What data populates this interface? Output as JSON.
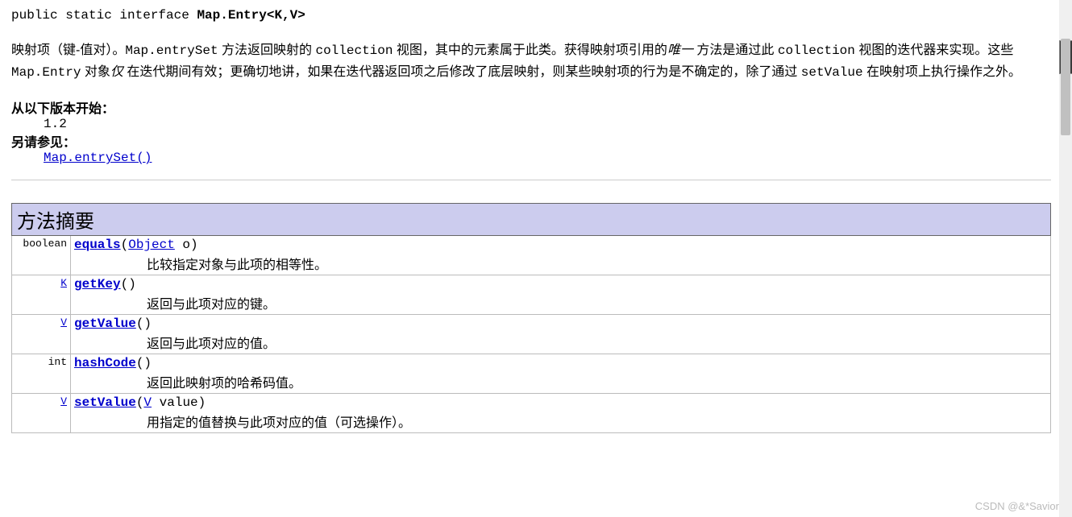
{
  "declaration": {
    "prefix": "public static interface ",
    "name": "Map.Entry<K,V>"
  },
  "description": {
    "p1a": "映射项（键-值对）。",
    "m1": "Map.entrySet",
    "p1b": " 方法返回映射的 ",
    "m2": "collection",
    "p1c": " 视图，其中的元素属于此类。获得映射项引用的",
    "only": "唯一",
    "p1d": " 方法是通过此 ",
    "m3": "collection",
    "p1e": " 视图的迭代器来实现。这些 ",
    "m4": "Map.Entry",
    "p1f": " 对象",
    "only2": "仅",
    "p1g": " 在迭代期间有效；更确切地讲，如果在迭代器返回项之后修改了底层映射，则某些映射项的行为是不确定的，除了通过 ",
    "m5": "setValue",
    "p1h": " 在映射项上执行操作之外。"
  },
  "meta": {
    "since_label": "从以下版本开始：",
    "since_value": "1.2",
    "see_label": "另请参见：",
    "see_link": "Map.entrySet()"
  },
  "summary": {
    "title": "方法摘要",
    "rows": [
      {
        "ret_link": "",
        "ret_text": "boolean",
        "method": "equals",
        "param_open": "(",
        "param_type": "Object",
        "param_name": " o",
        "param_close": ")",
        "desc": "比较指定对象与此项的相等性。"
      },
      {
        "ret_link": "K",
        "ret_text": "",
        "method": "getKey",
        "param_open": "(",
        "param_type": "",
        "param_name": "",
        "param_close": ")",
        "desc": "返回与此项对应的键。"
      },
      {
        "ret_link": "V",
        "ret_text": "",
        "method": "getValue",
        "param_open": "(",
        "param_type": "",
        "param_name": "",
        "param_close": ")",
        "desc": "返回与此项对应的值。"
      },
      {
        "ret_link": "",
        "ret_text": "int",
        "method": "hashCode",
        "param_open": "(",
        "param_type": "",
        "param_name": "",
        "param_close": ")",
        "desc": "返回此映射项的哈希码值。"
      },
      {
        "ret_link": "V",
        "ret_text": "",
        "method": "setValue",
        "param_open": "(",
        "param_type": "V",
        "param_name": " value",
        "param_close": ")",
        "desc": "用指定的值替换与此项对应的值（可选操作）。"
      }
    ]
  },
  "watermark": "CSDN @&*Savior"
}
